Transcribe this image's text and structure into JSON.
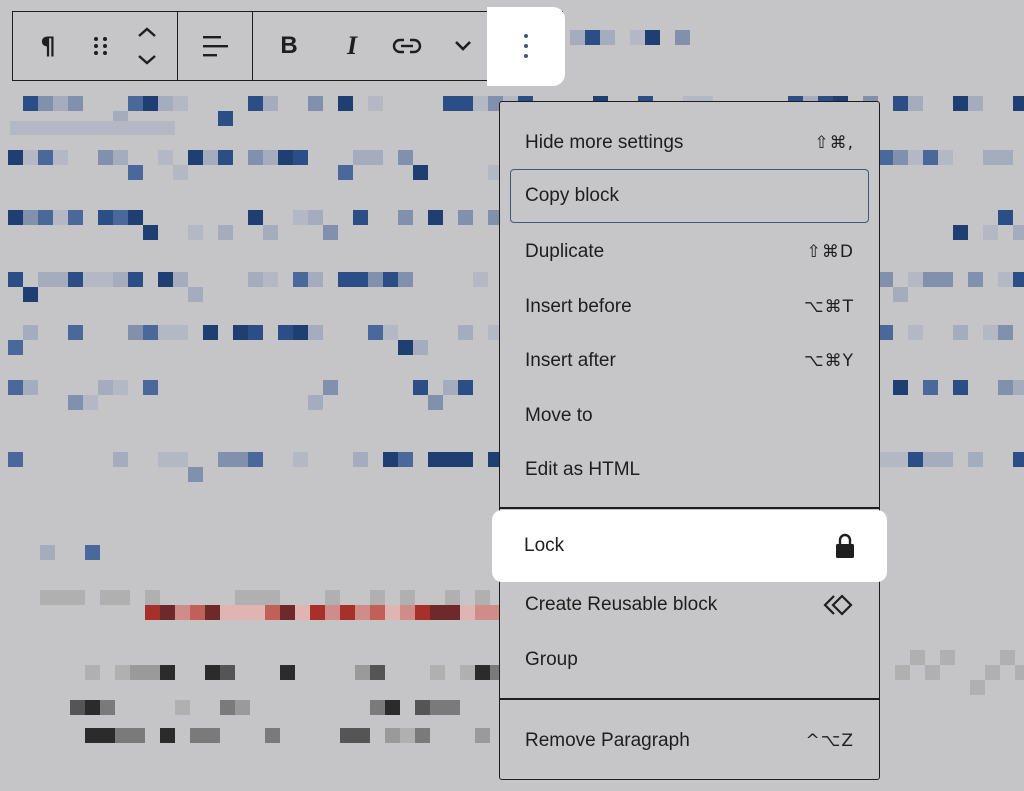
{
  "toolbar": {
    "paragraph_icon": "¶",
    "bold_label": "B",
    "italic_label": "I"
  },
  "menu": {
    "items": [
      {
        "label": "Hide more settings",
        "shortcut": "⇧⌘,"
      },
      {
        "label": "Copy block",
        "shortcut": ""
      },
      {
        "label": "Duplicate",
        "shortcut": "⇧⌘D"
      },
      {
        "label": "Insert before",
        "shortcut": "⌥⌘T"
      },
      {
        "label": "Insert after",
        "shortcut": "⌥⌘Y"
      },
      {
        "label": "Move to",
        "shortcut": ""
      },
      {
        "label": "Edit as HTML",
        "shortcut": ""
      },
      {
        "label": "Lock",
        "shortcut": ""
      },
      {
        "label": "Create Reusable block",
        "shortcut": ""
      },
      {
        "label": "Group",
        "shortcut": ""
      },
      {
        "label": "Remove Paragraph",
        "shortcut": "^⌥Z"
      }
    ]
  },
  "colors": {
    "background": "#c5c5c7",
    "border": "#1e1e1e",
    "focus_ring": "#3c5a7a",
    "highlight": "#ffffff"
  }
}
